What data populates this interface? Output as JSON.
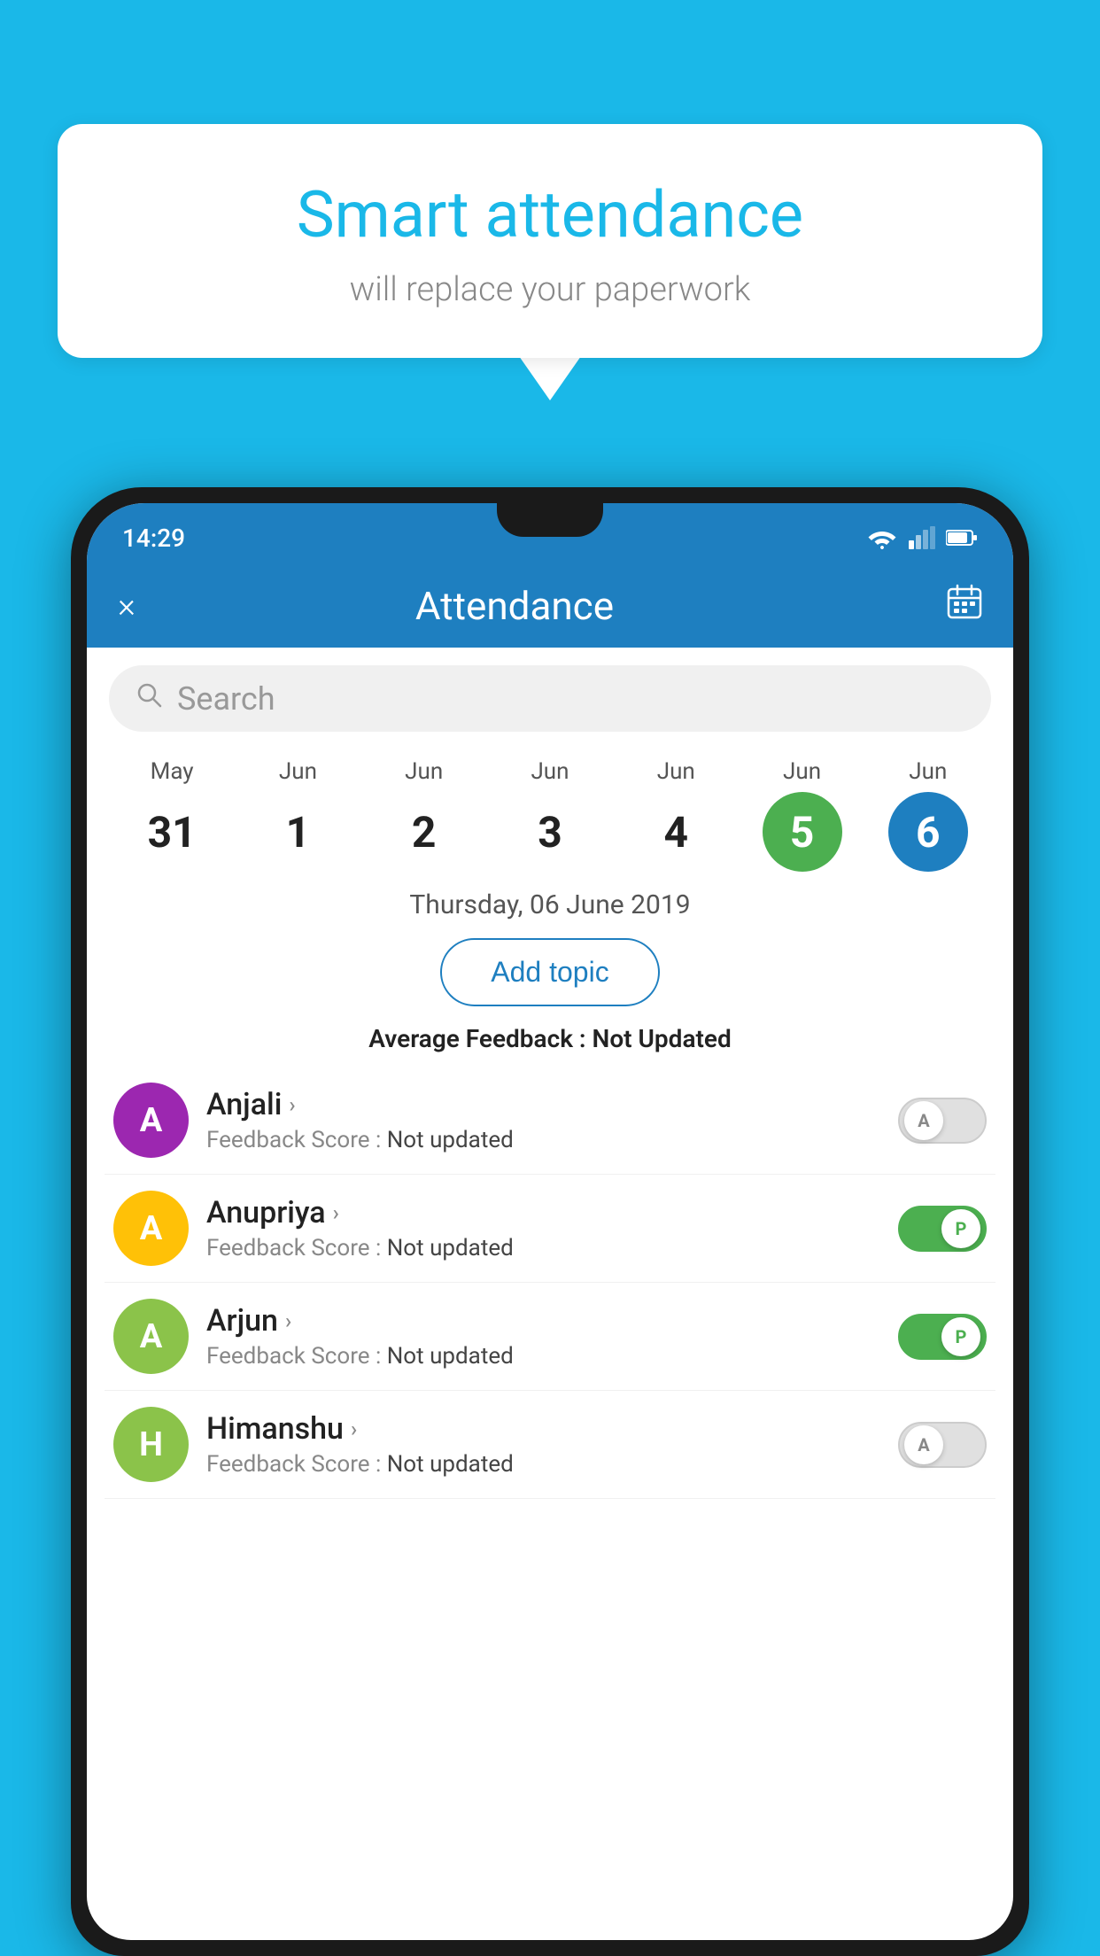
{
  "background_color": "#1ab8e8",
  "speech_bubble": {
    "title": "Smart attendance",
    "subtitle": "will replace your paperwork"
  },
  "status_bar": {
    "time": "14:29"
  },
  "header": {
    "title": "Attendance",
    "close_label": "×",
    "calendar_icon": "calendar-icon"
  },
  "search": {
    "placeholder": "Search"
  },
  "calendar": {
    "days": [
      {
        "month": "May",
        "day": "31",
        "state": "normal"
      },
      {
        "month": "Jun",
        "day": "1",
        "state": "normal"
      },
      {
        "month": "Jun",
        "day": "2",
        "state": "normal"
      },
      {
        "month": "Jun",
        "day": "3",
        "state": "normal"
      },
      {
        "month": "Jun",
        "day": "4",
        "state": "normal"
      },
      {
        "month": "Jun",
        "day": "5",
        "state": "today"
      },
      {
        "month": "Jun",
        "day": "6",
        "state": "selected"
      }
    ],
    "selected_date": "Thursday, 06 June 2019"
  },
  "add_topic_label": "Add topic",
  "avg_feedback_label": "Average Feedback :",
  "avg_feedback_value": "Not Updated",
  "students": [
    {
      "name": "Anjali",
      "avatar_letter": "A",
      "avatar_color": "#9c27b0",
      "feedback_label": "Feedback Score :",
      "feedback_value": "Not updated",
      "toggle_state": "off",
      "toggle_letter": "A"
    },
    {
      "name": "Anupriya",
      "avatar_letter": "A",
      "avatar_color": "#FFC107",
      "feedback_label": "Feedback Score :",
      "feedback_value": "Not updated",
      "toggle_state": "on",
      "toggle_letter": "P"
    },
    {
      "name": "Arjun",
      "avatar_letter": "A",
      "avatar_color": "#8bc34a",
      "feedback_label": "Feedback Score :",
      "feedback_value": "Not updated",
      "toggle_state": "on",
      "toggle_letter": "P"
    },
    {
      "name": "Himanshu",
      "avatar_letter": "H",
      "avatar_color": "#8bc34a",
      "feedback_label": "Feedback Score :",
      "feedback_value": "Not updated",
      "toggle_state": "off",
      "toggle_letter": "A"
    }
  ]
}
